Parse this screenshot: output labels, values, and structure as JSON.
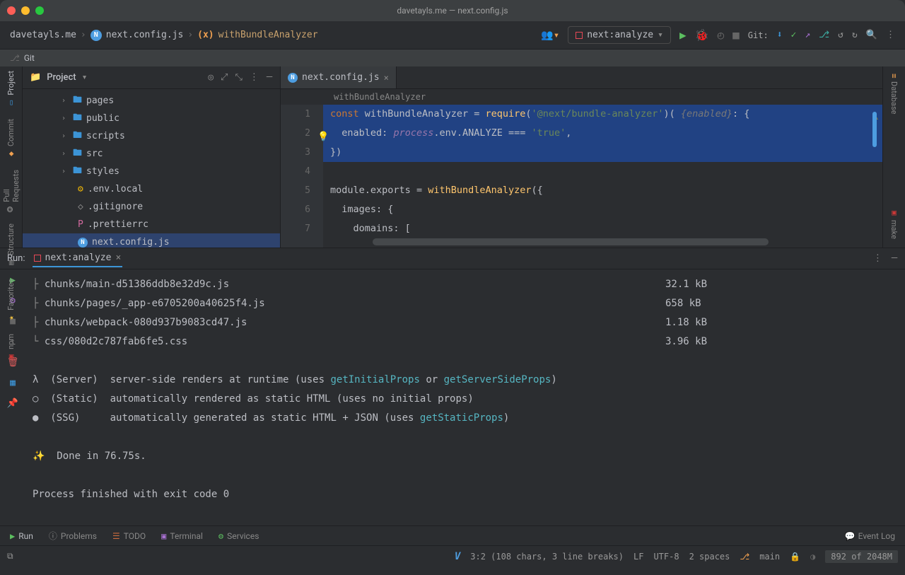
{
  "window": {
    "title": "davetayls.me — next.config.js"
  },
  "breadcrumbs": {
    "project": "davetayls.me",
    "file": "next.config.js",
    "symbol": "withBundleAnalyzer"
  },
  "runConfig": {
    "name": "next:analyze"
  },
  "git": {
    "label": "Git:"
  },
  "gitTab": {
    "label": "Git"
  },
  "leftRail": {
    "project": "Project",
    "commit": "Commit",
    "pullRequests": "Pull Requests",
    "structure": "Structure",
    "favorites": "Favorites",
    "npm": "npm"
  },
  "rightRail": {
    "database": "Database",
    "make": "make"
  },
  "projectPanel": {
    "title": "Project",
    "items": [
      {
        "kind": "dir",
        "name": "pages",
        "expandable": true
      },
      {
        "kind": "dir",
        "name": "public",
        "expandable": true
      },
      {
        "kind": "dir",
        "name": "scripts",
        "expandable": true
      },
      {
        "kind": "dir",
        "name": "src",
        "expandable": true
      },
      {
        "kind": "dir",
        "name": "styles",
        "expandable": true
      },
      {
        "kind": "file",
        "name": ".env.local",
        "icon": "yellow"
      },
      {
        "kind": "file",
        "name": ".gitignore",
        "icon": "gray"
      },
      {
        "kind": "file",
        "name": ".prettierrc",
        "icon": "pink"
      },
      {
        "kind": "file",
        "name": "next.config.js",
        "icon": "n",
        "selected": true
      }
    ]
  },
  "editor": {
    "tab": {
      "label": "next.config.js"
    },
    "inlineCrumb": "withBundleAnalyzer",
    "gutter": [
      "1",
      "2",
      "3",
      "4",
      "5",
      "6",
      "7"
    ],
    "code": {
      "l1_const": "const",
      "l1_name": "withBundleAnalyzer",
      "l1_eq": " = ",
      "l1_require": "require",
      "l1_pkg": "'@next/bundle-analyzer'",
      "l1_hint": "{enabled}",
      "l1_tail": ": {",
      "l2_indent": "  ",
      "l2_key": "enabled",
      "l2_colon": ": ",
      "l2_process": "process",
      "l2_env": ".env.ANALYZE === ",
      "l2_true": "'true'",
      "l2_comma": ",",
      "l3": "})",
      "l5_module": "module",
      "l5_exports": ".exports",
      "l5_eq": " = ",
      "l5_fn": "withBundleAnalyzer",
      "l5_open": "({",
      "l6_indent": "  ",
      "l6_key": "images",
      "l6_tail": ": {",
      "l7_indent": "    ",
      "l7_key": "domains",
      "l7_tail": ": ["
    }
  },
  "runPanel": {
    "heading": "Run:",
    "tabLabel": "next:analyze",
    "output": {
      "rows": [
        {
          "tree": "├ ",
          "path": "chunks/main-d51386ddb8e32d9c.js",
          "size": "32.1 kB"
        },
        {
          "tree": "├ ",
          "path": "chunks/pages/_app-e6705200a40625f4.js",
          "size": "658 kB"
        },
        {
          "tree": "├ ",
          "path": "chunks/webpack-080d937b9083cd47.js",
          "size": "1.18 kB"
        },
        {
          "tree": "└ ",
          "path": "css/080d2c787fab6fe5.css",
          "size": "3.96 kB"
        }
      ],
      "legend": {
        "server_sym": "λ",
        "server_label": "(Server)",
        "server_text_a": "server-side renders at runtime (uses ",
        "server_link1": "getInitialProps",
        "server_or": " or ",
        "server_link2": "getServerSideProps",
        "server_close": ")",
        "static_sym": "○",
        "static_label": "(Static)",
        "static_text": "automatically rendered as static HTML (uses no initial props)",
        "ssg_sym": "●",
        "ssg_label": "(SSG)",
        "ssg_text_a": "automatically generated as static HTML + JSON (uses ",
        "ssg_link": "getStaticProps",
        "ssg_close": ")"
      },
      "done": "✨  Done in 76.75s.",
      "exit": "Process finished with exit code 0"
    }
  },
  "bottomTabs": {
    "run": "Run",
    "problems": "Problems",
    "todo": "TODO",
    "terminal": "Terminal",
    "services": "Services",
    "eventLog": "Event Log"
  },
  "statusBar": {
    "cursor": "3:2 (108 chars, 3 line breaks)",
    "eol": "LF",
    "encoding": "UTF-8",
    "indent": "2 spaces",
    "branch": "main",
    "memory": "892 of 2048M"
  }
}
